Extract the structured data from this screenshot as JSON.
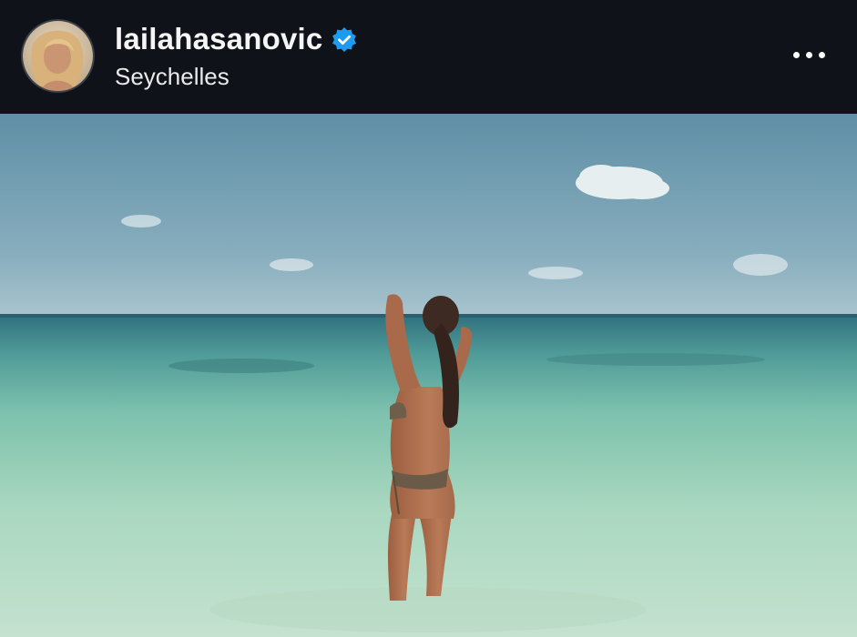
{
  "post": {
    "username": "lailahasanovic",
    "verified": true,
    "location": "Seychelles"
  },
  "icons": {
    "verified": "verified-badge-icon",
    "more": "more-options-icon"
  },
  "colors": {
    "header_bg": "#0f1218",
    "verified_blue": "#1d9bf0",
    "text": "#f5f5f5"
  }
}
